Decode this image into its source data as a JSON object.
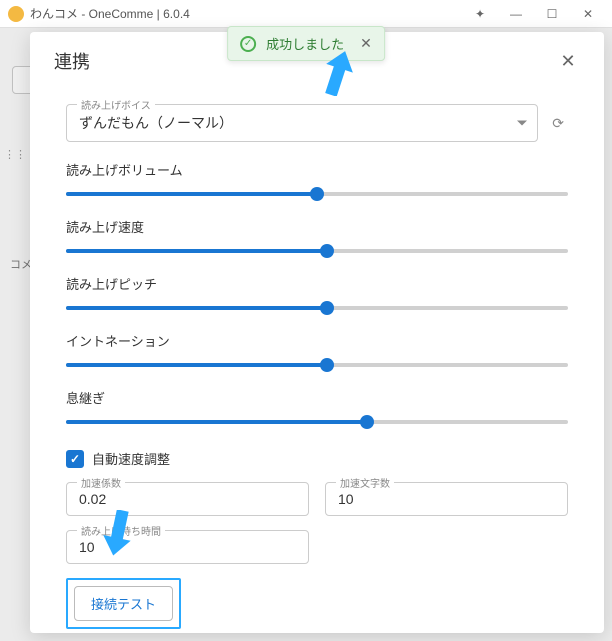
{
  "window": {
    "title": "わんコメ - OneComme | 6.0.4"
  },
  "background": {
    "sideLabel": "コメ"
  },
  "toast": {
    "message": "成功しました"
  },
  "modal": {
    "title": "連携",
    "voice": {
      "label": "読み上げボイス",
      "value": "ずんだもん（ノーマル）"
    },
    "sliders": [
      {
        "label": "読み上げボリューム",
        "percent": 50
      },
      {
        "label": "読み上げ速度",
        "percent": 52
      },
      {
        "label": "読み上げピッチ",
        "percent": 52
      },
      {
        "label": "イントネーション",
        "percent": 52
      },
      {
        "label": "息継ぎ",
        "percent": 60
      }
    ],
    "autoSpeed": {
      "label": "自動速度調整",
      "checked": true
    },
    "fields": {
      "accelFactor": {
        "label": "加速係数",
        "value": "0.02"
      },
      "accelChars": {
        "label": "加速文字数",
        "value": "10"
      },
      "waitInterval": {
        "label": "読み上げ待ち時間",
        "value": "10"
      }
    },
    "testButton": "接続テスト"
  }
}
